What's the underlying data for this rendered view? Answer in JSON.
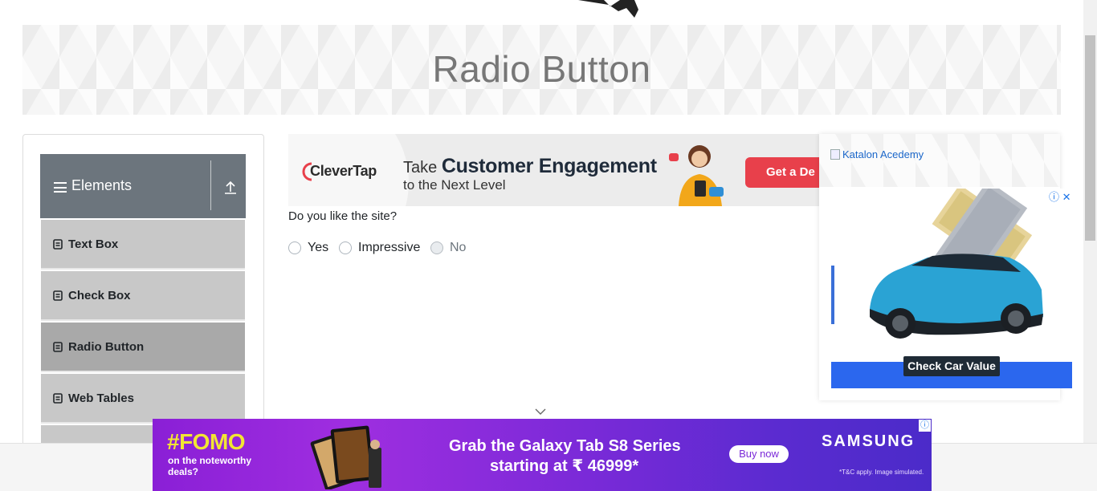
{
  "header": {
    "title": "Radio Button"
  },
  "sidebar": {
    "group_label": "Elements",
    "items": [
      {
        "label": "Text Box"
      },
      {
        "label": "Check Box"
      },
      {
        "label": "Radio Button",
        "active": true
      },
      {
        "label": "Web Tables"
      }
    ]
  },
  "main": {
    "question": "Do you like the site?",
    "radios": [
      {
        "label": "Yes",
        "checked": false,
        "disabled": false
      },
      {
        "label": "Impressive",
        "checked": false,
        "disabled": false
      },
      {
        "label": "No",
        "checked": false,
        "disabled": true
      }
    ]
  },
  "ads": {
    "clevertap": {
      "brand": "CleverTap",
      "line1_prefix": "Take",
      "line1_bold": "Customer Engagement",
      "line2": "to the Next Level",
      "cta": "Get a De"
    },
    "right": {
      "katalon_alt": "Katalon Acedemy",
      "cta": "Check Car Value"
    },
    "samsung": {
      "headline": "#FOMO",
      "sub": "on the noteworthy deals?",
      "line1": "Grab the Galaxy Tab S8 Series",
      "line2": "starting at ₹  46999*",
      "cta": "Buy now",
      "brand": "SAMSUNG",
      "terms": "*T&C apply. Image simulated."
    }
  },
  "colors": {
    "sidebar_header_bg": "#6c757d",
    "menu_item_bg": "#c8c8c8",
    "menu_item_active_bg": "#a9a9a9",
    "clevertap_cta": "#e8404b",
    "samsung_bg": "#8a1fd6",
    "fomo_text": "#f2e533"
  }
}
